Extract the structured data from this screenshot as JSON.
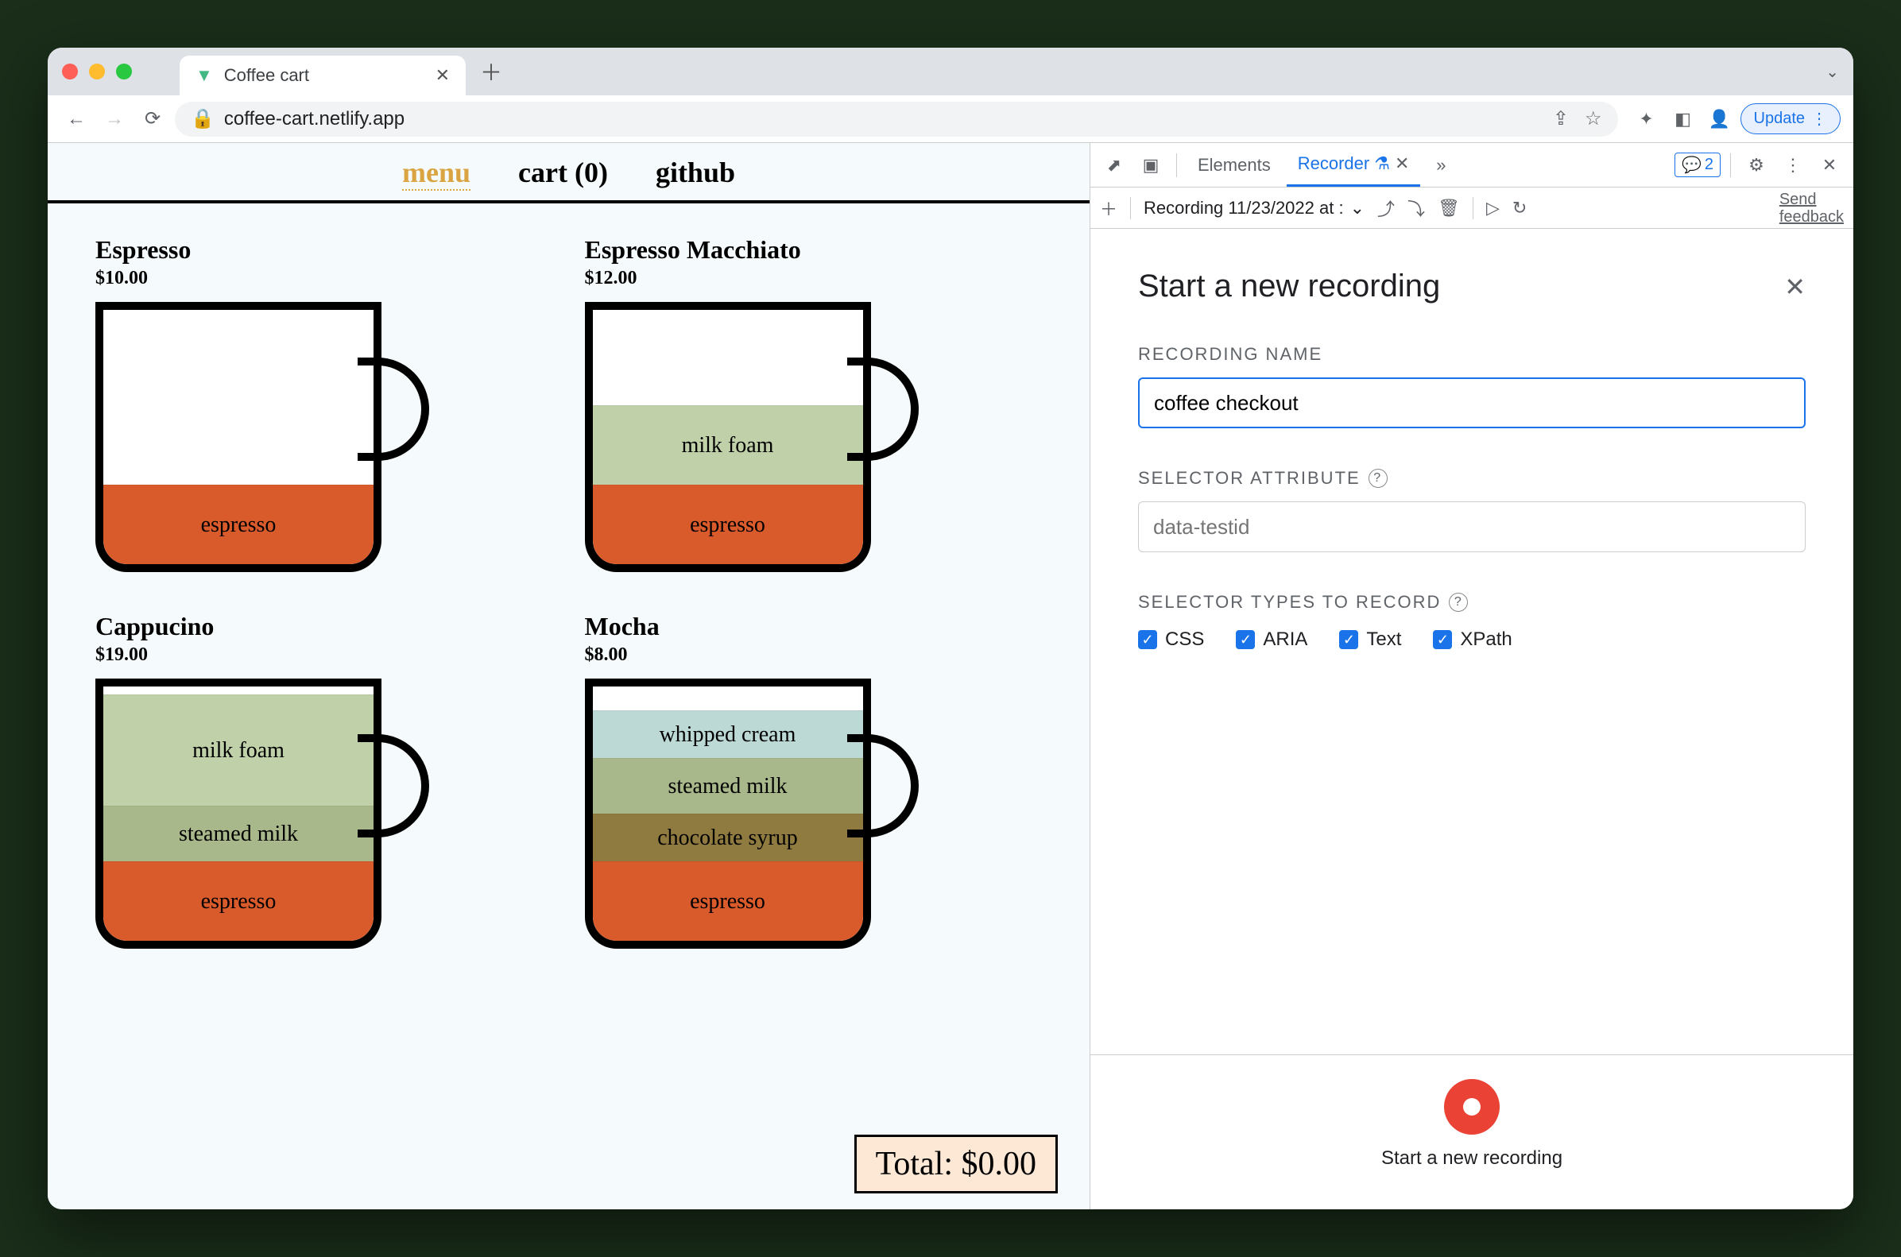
{
  "browser": {
    "tab_title": "Coffee cart",
    "url": "coffee-cart.netlify.app",
    "update_label": "Update"
  },
  "page": {
    "nav": {
      "menu": "menu",
      "cart": "cart (0)",
      "github": "github"
    },
    "products": [
      {
        "name": "Espresso",
        "price": "$10.00",
        "layers": [
          {
            "cls": "espresso-l",
            "label": "espresso"
          }
        ]
      },
      {
        "name": "Espresso Macchiato",
        "price": "$12.00",
        "layers": [
          {
            "cls": "milkfoam-l",
            "label": "milk foam"
          },
          {
            "cls": "espresso-l",
            "label": "espresso"
          }
        ]
      },
      {
        "name": "Cappucino",
        "price": "$19.00",
        "layers": [
          {
            "cls": "milkfoam-l",
            "label": "milk foam",
            "h": 140
          },
          {
            "cls": "steamed-l",
            "label": "steamed milk"
          },
          {
            "cls": "espresso-l",
            "label": "espresso"
          }
        ]
      },
      {
        "name": "Mocha",
        "price": "$8.00",
        "layers": [
          {
            "cls": "whipped-l",
            "label": "whipped cream"
          },
          {
            "cls": "steamed-l",
            "label": "steamed milk"
          },
          {
            "cls": "choco-l",
            "label": "chocolate syrup"
          },
          {
            "cls": "espresso-l",
            "label": "espresso"
          }
        ]
      }
    ],
    "total": "Total: $0.00"
  },
  "devtools": {
    "tabs": {
      "elements": "Elements",
      "recorder": "Recorder"
    },
    "issue_count": "2",
    "toolbar": {
      "recording_name_short": "Recording 11/23/2022 at :",
      "feedback": "Send feedback"
    },
    "panel": {
      "title": "Start a new recording",
      "name_label": "RECORDING NAME",
      "name_value": "coffee checkout",
      "selector_attr_label": "SELECTOR ATTRIBUTE",
      "selector_attr_placeholder": "data-testid",
      "selector_types_label": "SELECTOR TYPES TO RECORD",
      "types": {
        "css": "CSS",
        "aria": "ARIA",
        "text": "Text",
        "xpath": "XPath"
      },
      "start_label": "Start a new recording"
    }
  }
}
